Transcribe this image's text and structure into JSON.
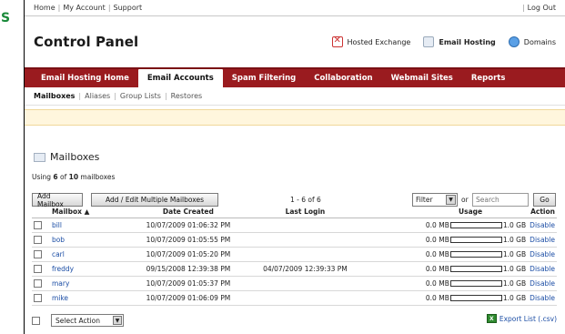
{
  "cut": {
    "letter": "S"
  },
  "topbar": {
    "links": [
      "Home",
      "My Account",
      "Support"
    ],
    "logout": "Log Out"
  },
  "header": {
    "title": "Control Panel",
    "products": [
      {
        "label": "Hosted Exchange",
        "icon": "exchange-icon"
      },
      {
        "label": "Email Hosting",
        "icon": "mail-icon"
      },
      {
        "label": "Domains",
        "icon": "globe-icon"
      }
    ]
  },
  "nav": [
    "Email Hosting Home",
    "Email Accounts",
    "Spam Filtering",
    "Collaboration",
    "Webmail Sites",
    "Reports"
  ],
  "subnav": [
    "Mailboxes",
    "Aliases",
    "Group Lists",
    "Restores"
  ],
  "section": {
    "title": "Mailboxes",
    "usage_prefix": "Using ",
    "used": "6",
    "usage_mid": " of ",
    "total": "10",
    "usage_suffix": " mailboxes"
  },
  "toolbar": {
    "add_mailbox": "Add Mailbox",
    "add_multiple": "Add / Edit Multiple Mailboxes",
    "pager": "1 - 6 of 6",
    "filter": "Filter",
    "or": "or",
    "search_placeholder": "Search",
    "go": "Go"
  },
  "table": {
    "headers": [
      "Mailbox ▲",
      "Date Created",
      "Last Login",
      "Usage",
      "Action"
    ],
    "rows": [
      {
        "name": "bill",
        "created": "10/07/2009 01:06:32 PM",
        "login": "",
        "used": "0.0 MB",
        "quota": "1.0 GB",
        "usage_fraction": 0,
        "action": "Disable"
      },
      {
        "name": "bob",
        "created": "10/07/2009 01:05:55 PM",
        "login": "",
        "used": "0.0 MB",
        "quota": "1.0 GB",
        "usage_fraction": 0,
        "action": "Disable"
      },
      {
        "name": "carl",
        "created": "10/07/2009 01:05:20 PM",
        "login": "",
        "used": "0.0 MB",
        "quota": "1.0 GB",
        "usage_fraction": 0,
        "action": "Disable"
      },
      {
        "name": "freddy",
        "created": "09/15/2008 12:39:38 PM",
        "login": "04/07/2009 12:39:33 PM",
        "used": "0.0 MB",
        "quota": "1.0 GB",
        "usage_fraction": 0,
        "action": "Disable"
      },
      {
        "name": "mary",
        "created": "10/07/2009 01:05:37 PM",
        "login": "",
        "used": "0.0 MB",
        "quota": "1.0 GB",
        "usage_fraction": 0,
        "action": "Disable"
      },
      {
        "name": "mike",
        "created": "10/07/2009 01:06:09 PM",
        "login": "",
        "used": "0.0 MB",
        "quota": "1.0 GB",
        "usage_fraction": 0,
        "action": "Disable"
      }
    ]
  },
  "footer": {
    "select_action": "Select Action",
    "export": "Export List (.csv)"
  },
  "colors": {
    "nav_bg": "#9a1b1f",
    "link": "#1c4ea5",
    "banner": "#fff6dd"
  }
}
